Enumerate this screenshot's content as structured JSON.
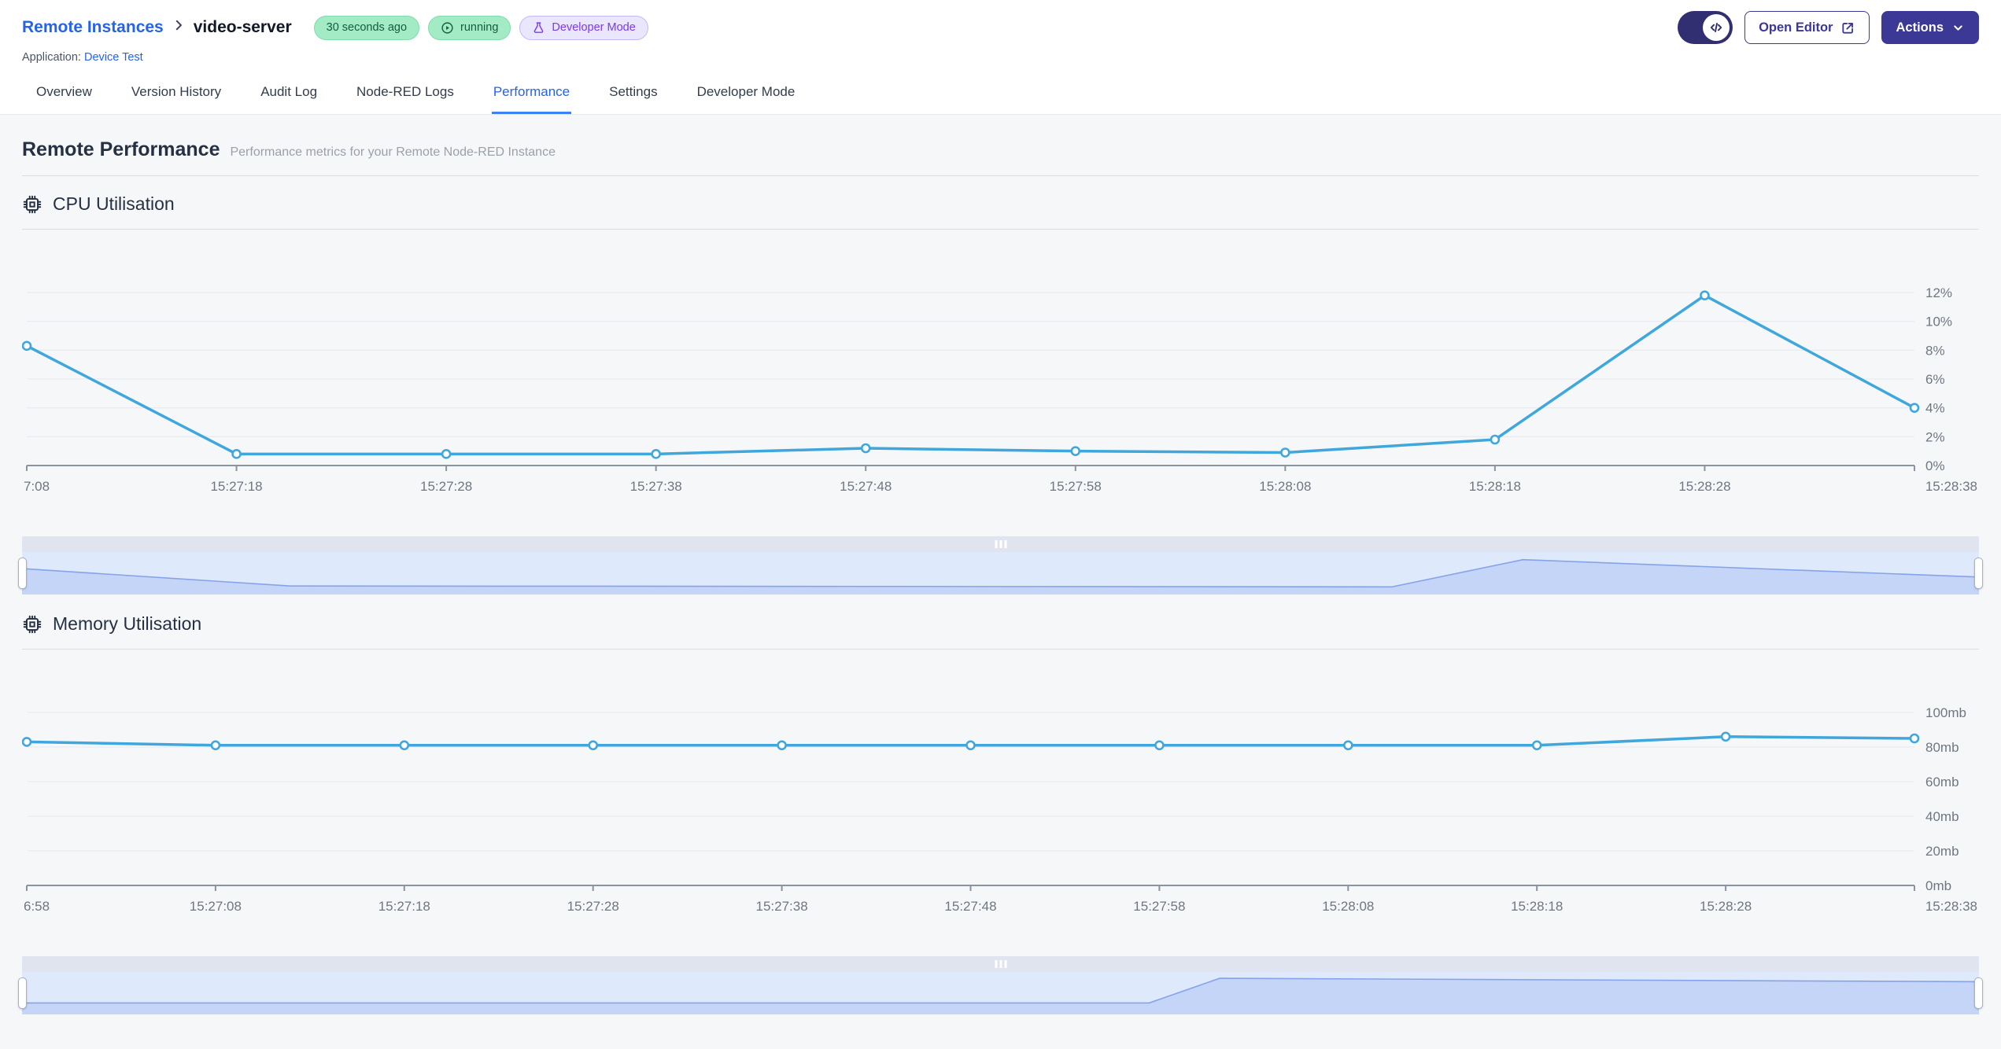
{
  "header": {
    "breadcrumb_parent": "Remote Instances",
    "breadcrumb_separator": "›",
    "instance_name": "video-server",
    "badges": {
      "last_seen": "30 seconds ago",
      "status": "running",
      "developer_mode": "Developer Mode"
    },
    "application_label": "Application:",
    "application_name": "Device Test",
    "open_editor_label": "Open Editor",
    "actions_label": "Actions"
  },
  "tabs": {
    "active": "Performance",
    "items": [
      {
        "label": "Overview"
      },
      {
        "label": "Version History"
      },
      {
        "label": "Audit Log"
      },
      {
        "label": "Node-RED Logs"
      },
      {
        "label": "Performance"
      },
      {
        "label": "Settings"
      },
      {
        "label": "Developer Mode"
      }
    ]
  },
  "main": {
    "title": "Remote Performance",
    "subtitle": "Performance metrics for your Remote Node-RED Instance"
  },
  "colors": {
    "accent_blue": "#2563eb",
    "indigo": "#3b3896",
    "badge_green": "#a3ebc4",
    "badge_purple": "#eae6fd",
    "chart_line": "#3fa7dc",
    "brush_fill": "#c5d5f7",
    "brush_line": "#86a3ea"
  },
  "chart_data": [
    {
      "type": "line",
      "title": "CPU Utilisation",
      "x_labels": [
        "7:08",
        "15:27:18",
        "15:27:28",
        "15:27:38",
        "15:27:48",
        "15:27:58",
        "15:28:08",
        "15:28:18",
        "15:28:28",
        "15:28:38"
      ],
      "values": [
        8.3,
        0.8,
        0.8,
        0.8,
        1.2,
        1.0,
        0.9,
        1.8,
        11.8,
        4.0
      ],
      "ylabel": "",
      "ylim": [
        0,
        12
      ],
      "y_tick_values": [
        0,
        2,
        4,
        6,
        8,
        10,
        12
      ],
      "y_ticks": [
        "0%",
        "2%",
        "4%",
        "6%",
        "8%",
        "10%",
        "12%"
      ],
      "legend": "none",
      "grid": "horizontal",
      "line_color": "#3fa7dc",
      "brush": {
        "points_x": [
          0,
          0.137,
          0.44,
          0.7,
          0.767,
          1
        ],
        "points_y": [
          0.39,
          0.8,
          0.81,
          0.82,
          0.18,
          0.59
        ]
      }
    },
    {
      "type": "line",
      "title": "Memory Utilisation",
      "x_labels": [
        "6:58",
        "15:27:08",
        "15:27:18",
        "15:27:28",
        "15:27:38",
        "15:27:48",
        "15:27:58",
        "15:28:08",
        "15:28:18",
        "15:28:28",
        "15:28:38"
      ],
      "values": [
        83,
        81,
        81,
        81,
        81,
        81,
        81,
        81,
        81,
        86,
        85
      ],
      "ylabel": "",
      "ylim": [
        0,
        100
      ],
      "y_tick_values": [
        0,
        20,
        40,
        60,
        80,
        100
      ],
      "y_ticks": [
        "0mb",
        "20mb",
        "40mb",
        "60mb",
        "80mb",
        "100mb"
      ],
      "legend": "none",
      "grid": "horizontal",
      "line_color": "#3fa7dc",
      "brush": {
        "points_x": [
          0,
          0.576,
          0.612,
          1
        ],
        "points_y": [
          0.73,
          0.73,
          0.15,
          0.23
        ]
      }
    }
  ]
}
